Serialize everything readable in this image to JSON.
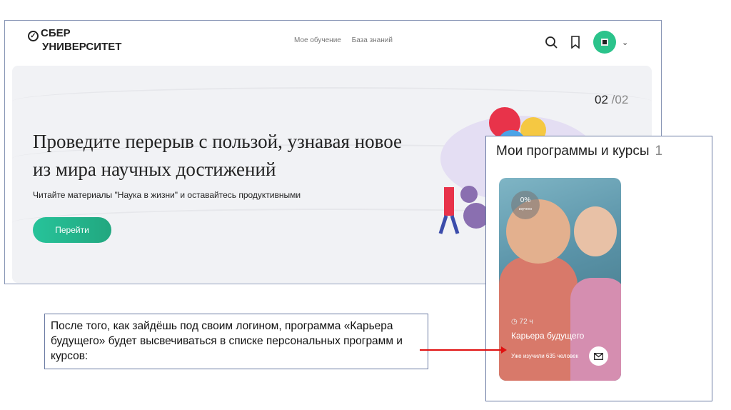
{
  "header": {
    "logo_line1": "СБЕР",
    "logo_line2": "УНИВЕРСИТЕТ",
    "nav": [
      "Мое обучение",
      "База знаний"
    ]
  },
  "banner": {
    "counter_current": "02",
    "counter_total": "/02",
    "title": "Проведите перерыв с пользой, узнавая новое из мира научных достижений",
    "subtitle": "Читайте материалы \"Наука в жизни\" и оставайтесь продуктивными",
    "button": "Перейти"
  },
  "programs": {
    "title": "Мои программы и курсы",
    "count": "1",
    "card": {
      "progress": "0%",
      "progress_label": "изучено",
      "hours": "72 ч",
      "name": "Карьера будущего",
      "learned": "Уже изучили 635 человек"
    }
  },
  "note": "После того, как зайдёшь под своим логином, программа «Карьера будущего» будет высвечиваться в списке персональных программ и курсов:"
}
